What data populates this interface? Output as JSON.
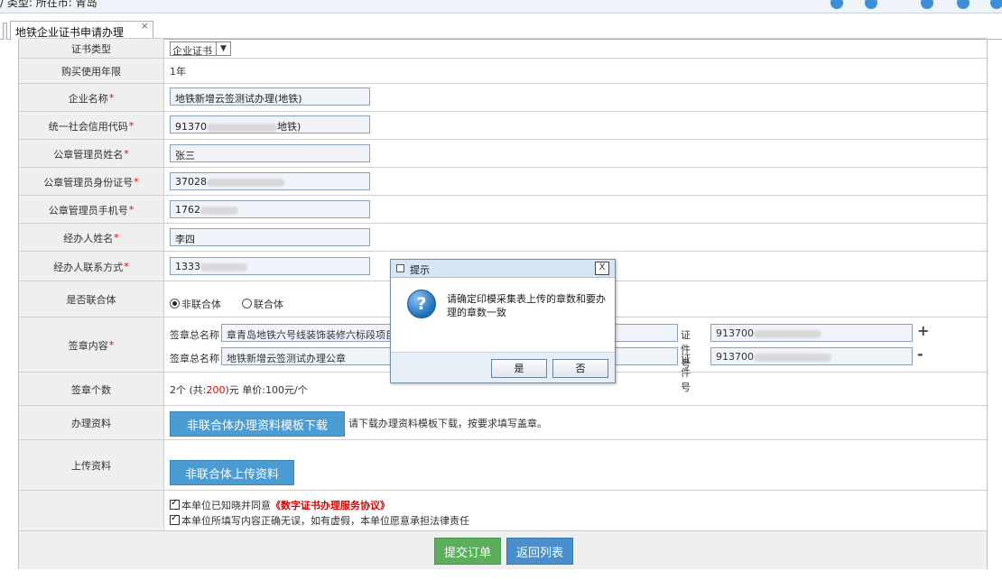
{
  "top": {
    "info": "/ 类型:      所在市: 青岛"
  },
  "tab": {
    "title": "地铁企业证书申请办理",
    "close": "×"
  },
  "form": {
    "cert_type": {
      "label": "证书类型",
      "value": "企业证书"
    },
    "years": {
      "label": "购买使用年限",
      "value": "1年"
    },
    "company": {
      "label": "企业名称",
      "req": "*",
      "value": "地铁新增云签测试办理(地铁)"
    },
    "credit_code": {
      "label": "统一社会信用代码",
      "req": "*",
      "prefix": "91370",
      "suffix": "地铁)"
    },
    "admin_name": {
      "label": "公章管理员姓名",
      "req": "*",
      "value": "张三"
    },
    "admin_id": {
      "label": "公章管理员身份证号",
      "req": "*",
      "prefix": "37028"
    },
    "admin_phone": {
      "label": "公章管理员手机号",
      "req": "*",
      "prefix": "1762"
    },
    "agent_name": {
      "label": "经办人姓名",
      "req": "*",
      "value": "李四"
    },
    "agent_contact": {
      "label": "经办人联系方式",
      "req": "*",
      "prefix": "1333"
    },
    "joint": {
      "label": "是否联合体",
      "opt1": "非联合体",
      "opt2": "联合体"
    },
    "seal": {
      "label": "签章内容",
      "req": "*",
      "name_caption": "签章总名称",
      "cert_caption": "证件号",
      "rows": [
        {
          "name": "章青岛地铁六号线装饰装修六标段项目",
          "cert": "913700",
          "op": "+"
        },
        {
          "name": "地铁新增云签测试办理公章",
          "cert": "913700",
          "op": "-"
        }
      ]
    },
    "seal_count": {
      "label": "签章个数",
      "pre": "2个 (共:",
      "amount": "200",
      "post": ")元 单价:100元/个"
    },
    "materials": {
      "label": "办理资料",
      "button": "非联合体办理资料模板下载",
      "hint": "请下载办理资料模板下载，按要求填写盖章。"
    },
    "upload": {
      "label": "上传资料",
      "button": "非联合体上传资料"
    },
    "agreement": {
      "pre": "本单位已知晓并同意",
      "link": "《数字证书办理服务协议》",
      "promise": "本单位所填写内容正确无误，如有虚假，本单位愿意承担法律责任"
    },
    "submit": "提交订单",
    "back": "返回列表"
  },
  "dialog": {
    "title": "提示",
    "close": "X",
    "message": "请确定印模采集表上传的章数和要办理的章数一致",
    "yes": "是",
    "no": "否"
  },
  "colors": {
    "required": "#ee0000",
    "primary_button": "#4b9cd3",
    "submit_button": "#5cae5c",
    "link_red": "#dd0000"
  },
  "icons": {
    "dialog": "question-icon"
  }
}
